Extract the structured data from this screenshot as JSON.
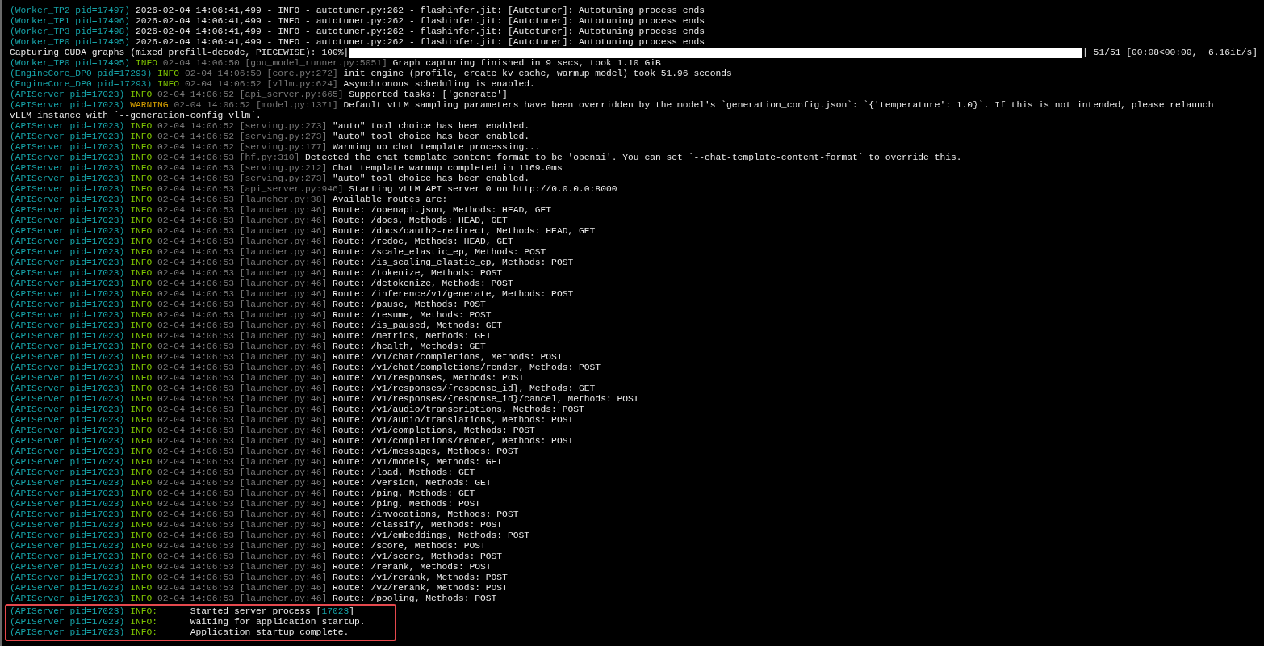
{
  "lines": [
    {
      "kind": "plain",
      "source": "(Worker_TP2 pid=17497)",
      "message": "2026-02-04 14:06:41,499 - INFO - autotuner.py:262 - flashinfer.jit: [Autotuner]: Autotuning process ends"
    },
    {
      "kind": "plain",
      "source": "(Worker_TP1 pid=17496)",
      "message": "2026-02-04 14:06:41,499 - INFO - autotuner.py:262 - flashinfer.jit: [Autotuner]: Autotuning process ends"
    },
    {
      "kind": "plain",
      "source": "(Worker_TP3 pid=17498)",
      "message": "2026-02-04 14:06:41,499 - INFO - autotuner.py:262 - flashinfer.jit: [Autotuner]: Autotuning process ends"
    },
    {
      "kind": "plain",
      "source": "(Worker_TP0 pid=17495)",
      "message": "2026-02-04 14:06:41,499 - INFO - autotuner.py:262 - flashinfer.jit: [Autotuner]: Autotuning process ends"
    },
    {
      "kind": "progress",
      "label": "Capturing CUDA graphs (mixed prefill-decode, PIECEWISE): 100%|",
      "level": 1,
      "tail": "| 51/51 [00:08<00:00,  6.16it/s]"
    },
    {
      "kind": "log",
      "source": "(Worker_TP0 pid=17495)",
      "color": "#7ec500",
      "level": "INFO",
      "time": "02-04 14:06:50",
      "location": "[gpu_model_runner.py:5051]",
      "message": "Graph capturing finished in 9 secs, took 1.10 GiB"
    },
    {
      "kind": "log",
      "source": "(EngineCore_DP0 pid=17293)",
      "color": "#7ec500",
      "level": "INFO",
      "time": "02-04 14:06:50",
      "location": "[core.py:272]",
      "message": "init engine (profile, create kv cache, warmup model) took 51.96 seconds"
    },
    {
      "kind": "log",
      "source": "(EngineCore_DP0 pid=17293)",
      "color": "#7ec500",
      "level": "INFO",
      "time": "02-04 14:06:52",
      "location": "[vllm.py:624]",
      "message": "Asynchronous scheduling is enabled."
    },
    {
      "kind": "log",
      "source": "(APIServer pid=17023)",
      "color": "#7ec500",
      "level": "INFO",
      "time": "02-04 14:06:52",
      "location": "[api_server.py:665]",
      "message": "Supported tasks: ['generate']"
    },
    {
      "kind": "log",
      "source": "(APIServer pid=17023)",
      "color": "#d7a000",
      "level": "WARNING",
      "time": "02-04 14:06:52",
      "location": "[model.py:1371]",
      "message": "Default vLLM sampling parameters have been overridden by the model's `generation_config.json`: `{'temperature': 1.0}`. If this is not intended, please relaunch"
    },
    {
      "kind": "continuation",
      "message": "vLLM instance with `--generation-config vllm`."
    },
    {
      "kind": "log",
      "source": "(APIServer pid=17023)",
      "color": "#7ec500",
      "level": "INFO",
      "time": "02-04 14:06:52",
      "location": "[serving.py:273]",
      "message": "\"auto\" tool choice has been enabled."
    },
    {
      "kind": "log",
      "source": "(APIServer pid=17023)",
      "color": "#7ec500",
      "level": "INFO",
      "time": "02-04 14:06:52",
      "location": "[serving.py:273]",
      "message": "\"auto\" tool choice has been enabled."
    },
    {
      "kind": "log",
      "source": "(APIServer pid=17023)",
      "color": "#7ec500",
      "level": "INFO",
      "time": "02-04 14:06:52",
      "location": "[serving.py:177]",
      "message": "Warming up chat template processing..."
    },
    {
      "kind": "log",
      "source": "(APIServer pid=17023)",
      "color": "#7ec500",
      "level": "INFO",
      "time": "02-04 14:06:53",
      "location": "[hf.py:310]",
      "message": "Detected the chat template content format to be 'openai'. You can set `--chat-template-content-format` to override this."
    },
    {
      "kind": "log",
      "source": "(APIServer pid=17023)",
      "color": "#7ec500",
      "level": "INFO",
      "time": "02-04 14:06:53",
      "location": "[serving.py:212]",
      "message": "Chat template warmup completed in 1169.0ms"
    },
    {
      "kind": "log",
      "source": "(APIServer pid=17023)",
      "color": "#7ec500",
      "level": "INFO",
      "time": "02-04 14:06:53",
      "location": "[serving.py:273]",
      "message": "\"auto\" tool choice has been enabled."
    },
    {
      "kind": "log",
      "source": "(APIServer pid=17023)",
      "color": "#7ec500",
      "level": "INFO",
      "time": "02-04 14:06:53",
      "location": "[api_server.py:946]",
      "message": "Starting vLLM API server 0 on http://0.0.0.0:8000"
    },
    {
      "kind": "log",
      "source": "(APIServer pid=17023)",
      "color": "#7ec500",
      "level": "INFO",
      "time": "02-04 14:06:53",
      "location": "[launcher.py:38]",
      "message": "Available routes are:"
    },
    {
      "kind": "log",
      "source": "(APIServer pid=17023)",
      "color": "#7ec500",
      "level": "INFO",
      "time": "02-04 14:06:53",
      "location": "[launcher.py:46]",
      "message": "Route: /openapi.json, Methods: HEAD, GET"
    },
    {
      "kind": "log",
      "source": "(APIServer pid=17023)",
      "color": "#7ec500",
      "level": "INFO",
      "time": "02-04 14:06:53",
      "location": "[launcher.py:46]",
      "message": "Route: /docs, Methods: HEAD, GET"
    },
    {
      "kind": "log",
      "source": "(APIServer pid=17023)",
      "color": "#7ec500",
      "level": "INFO",
      "time": "02-04 14:06:53",
      "location": "[launcher.py:46]",
      "message": "Route: /docs/oauth2-redirect, Methods: HEAD, GET"
    },
    {
      "kind": "log",
      "source": "(APIServer pid=17023)",
      "color": "#7ec500",
      "level": "INFO",
      "time": "02-04 14:06:53",
      "location": "[launcher.py:46]",
      "message": "Route: /redoc, Methods: HEAD, GET"
    },
    {
      "kind": "log",
      "source": "(APIServer pid=17023)",
      "color": "#7ec500",
      "level": "INFO",
      "time": "02-04 14:06:53",
      "location": "[launcher.py:46]",
      "message": "Route: /scale_elastic_ep, Methods: POST"
    },
    {
      "kind": "log",
      "source": "(APIServer pid=17023)",
      "color": "#7ec500",
      "level": "INFO",
      "time": "02-04 14:06:53",
      "location": "[launcher.py:46]",
      "message": "Route: /is_scaling_elastic_ep, Methods: POST"
    },
    {
      "kind": "log",
      "source": "(APIServer pid=17023)",
      "color": "#7ec500",
      "level": "INFO",
      "time": "02-04 14:06:53",
      "location": "[launcher.py:46]",
      "message": "Route: /tokenize, Methods: POST"
    },
    {
      "kind": "log",
      "source": "(APIServer pid=17023)",
      "color": "#7ec500",
      "level": "INFO",
      "time": "02-04 14:06:53",
      "location": "[launcher.py:46]",
      "message": "Route: /detokenize, Methods: POST"
    },
    {
      "kind": "log",
      "source": "(APIServer pid=17023)",
      "color": "#7ec500",
      "level": "INFO",
      "time": "02-04 14:06:53",
      "location": "[launcher.py:46]",
      "message": "Route: /inference/v1/generate, Methods: POST"
    },
    {
      "kind": "log",
      "source": "(APIServer pid=17023)",
      "color": "#7ec500",
      "level": "INFO",
      "time": "02-04 14:06:53",
      "location": "[launcher.py:46]",
      "message": "Route: /pause, Methods: POST"
    },
    {
      "kind": "log",
      "source": "(APIServer pid=17023)",
      "color": "#7ec500",
      "level": "INFO",
      "time": "02-04 14:06:53",
      "location": "[launcher.py:46]",
      "message": "Route: /resume, Methods: POST"
    },
    {
      "kind": "log",
      "source": "(APIServer pid=17023)",
      "color": "#7ec500",
      "level": "INFO",
      "time": "02-04 14:06:53",
      "location": "[launcher.py:46]",
      "message": "Route: /is_paused, Methods: GET"
    },
    {
      "kind": "log",
      "source": "(APIServer pid=17023)",
      "color": "#7ec500",
      "level": "INFO",
      "time": "02-04 14:06:53",
      "location": "[launcher.py:46]",
      "message": "Route: /metrics, Methods: GET"
    },
    {
      "kind": "log",
      "source": "(APIServer pid=17023)",
      "color": "#7ec500",
      "level": "INFO",
      "time": "02-04 14:06:53",
      "location": "[launcher.py:46]",
      "message": "Route: /health, Methods: GET"
    },
    {
      "kind": "log",
      "source": "(APIServer pid=17023)",
      "color": "#7ec500",
      "level": "INFO",
      "time": "02-04 14:06:53",
      "location": "[launcher.py:46]",
      "message": "Route: /v1/chat/completions, Methods: POST"
    },
    {
      "kind": "log",
      "source": "(APIServer pid=17023)",
      "color": "#7ec500",
      "level": "INFO",
      "time": "02-04 14:06:53",
      "location": "[launcher.py:46]",
      "message": "Route: /v1/chat/completions/render, Methods: POST"
    },
    {
      "kind": "log",
      "source": "(APIServer pid=17023)",
      "color": "#7ec500",
      "level": "INFO",
      "time": "02-04 14:06:53",
      "location": "[launcher.py:46]",
      "message": "Route: /v1/responses, Methods: POST"
    },
    {
      "kind": "log",
      "source": "(APIServer pid=17023)",
      "color": "#7ec500",
      "level": "INFO",
      "time": "02-04 14:06:53",
      "location": "[launcher.py:46]",
      "message": "Route: /v1/responses/{response_id}, Methods: GET"
    },
    {
      "kind": "log",
      "source": "(APIServer pid=17023)",
      "color": "#7ec500",
      "level": "INFO",
      "time": "02-04 14:06:53",
      "location": "[launcher.py:46]",
      "message": "Route: /v1/responses/{response_id}/cancel, Methods: POST"
    },
    {
      "kind": "log",
      "source": "(APIServer pid=17023)",
      "color": "#7ec500",
      "level": "INFO",
      "time": "02-04 14:06:53",
      "location": "[launcher.py:46]",
      "message": "Route: /v1/audio/transcriptions, Methods: POST"
    },
    {
      "kind": "log",
      "source": "(APIServer pid=17023)",
      "color": "#7ec500",
      "level": "INFO",
      "time": "02-04 14:06:53",
      "location": "[launcher.py:46]",
      "message": "Route: /v1/audio/translations, Methods: POST"
    },
    {
      "kind": "log",
      "source": "(APIServer pid=17023)",
      "color": "#7ec500",
      "level": "INFO",
      "time": "02-04 14:06:53",
      "location": "[launcher.py:46]",
      "message": "Route: /v1/completions, Methods: POST"
    },
    {
      "kind": "log",
      "source": "(APIServer pid=17023)",
      "color": "#7ec500",
      "level": "INFO",
      "time": "02-04 14:06:53",
      "location": "[launcher.py:46]",
      "message": "Route: /v1/completions/render, Methods: POST"
    },
    {
      "kind": "log",
      "source": "(APIServer pid=17023)",
      "color": "#7ec500",
      "level": "INFO",
      "time": "02-04 14:06:53",
      "location": "[launcher.py:46]",
      "message": "Route: /v1/messages, Methods: POST"
    },
    {
      "kind": "log",
      "source": "(APIServer pid=17023)",
      "color": "#7ec500",
      "level": "INFO",
      "time": "02-04 14:06:53",
      "location": "[launcher.py:46]",
      "message": "Route: /v1/models, Methods: GET"
    },
    {
      "kind": "log",
      "source": "(APIServer pid=17023)",
      "color": "#7ec500",
      "level": "INFO",
      "time": "02-04 14:06:53",
      "location": "[launcher.py:46]",
      "message": "Route: /load, Methods: GET"
    },
    {
      "kind": "log",
      "source": "(APIServer pid=17023)",
      "color": "#7ec500",
      "level": "INFO",
      "time": "02-04 14:06:53",
      "location": "[launcher.py:46]",
      "message": "Route: /version, Methods: GET"
    },
    {
      "kind": "log",
      "source": "(APIServer pid=17023)",
      "color": "#7ec500",
      "level": "INFO",
      "time": "02-04 14:06:53",
      "location": "[launcher.py:46]",
      "message": "Route: /ping, Methods: GET"
    },
    {
      "kind": "log",
      "source": "(APIServer pid=17023)",
      "color": "#7ec500",
      "level": "INFO",
      "time": "02-04 14:06:53",
      "location": "[launcher.py:46]",
      "message": "Route: /ping, Methods: POST"
    },
    {
      "kind": "log",
      "source": "(APIServer pid=17023)",
      "color": "#7ec500",
      "level": "INFO",
      "time": "02-04 14:06:53",
      "location": "[launcher.py:46]",
      "message": "Route: /invocations, Methods: POST"
    },
    {
      "kind": "log",
      "source": "(APIServer pid=17023)",
      "color": "#7ec500",
      "level": "INFO",
      "time": "02-04 14:06:53",
      "location": "[launcher.py:46]",
      "message": "Route: /classify, Methods: POST"
    },
    {
      "kind": "log",
      "source": "(APIServer pid=17023)",
      "color": "#7ec500",
      "level": "INFO",
      "time": "02-04 14:06:53",
      "location": "[launcher.py:46]",
      "message": "Route: /v1/embeddings, Methods: POST"
    },
    {
      "kind": "log",
      "source": "(APIServer pid=17023)",
      "color": "#7ec500",
      "level": "INFO",
      "time": "02-04 14:06:53",
      "location": "[launcher.py:46]",
      "message": "Route: /score, Methods: POST"
    },
    {
      "kind": "log",
      "source": "(APIServer pid=17023)",
      "color": "#7ec500",
      "level": "INFO",
      "time": "02-04 14:06:53",
      "location": "[launcher.py:46]",
      "message": "Route: /v1/score, Methods: POST"
    },
    {
      "kind": "log",
      "source": "(APIServer pid=17023)",
      "color": "#7ec500",
      "level": "INFO",
      "time": "02-04 14:06:53",
      "location": "[launcher.py:46]",
      "message": "Route: /rerank, Methods: POST"
    },
    {
      "kind": "log",
      "source": "(APIServer pid=17023)",
      "color": "#7ec500",
      "level": "INFO",
      "time": "02-04 14:06:53",
      "location": "[launcher.py:46]",
      "message": "Route: /v1/rerank, Methods: POST"
    },
    {
      "kind": "log",
      "source": "(APIServer pid=17023)",
      "color": "#7ec500",
      "level": "INFO",
      "time": "02-04 14:06:53",
      "location": "[launcher.py:46]",
      "message": "Route: /v2/rerank, Methods: POST"
    },
    {
      "kind": "log",
      "source": "(APIServer pid=17023)",
      "color": "#7ec500",
      "level": "INFO",
      "time": "02-04 14:06:53",
      "location": "[launcher.py:46]",
      "message": "Route: /pooling, Methods: POST"
    }
  ],
  "highlighted_lines": [
    {
      "source": "(APIServer pid=17023)",
      "color": "#7ec500",
      "level": "INFO:",
      "message": "Started server process [",
      "pid": "17023",
      "message_end": "]"
    },
    {
      "source": "(APIServer pid=17023)",
      "color": "#7ec500",
      "level": "INFO:",
      "message": "Waiting for application startup."
    },
    {
      "source": "(APIServer pid=17023)",
      "color": "#7ec500",
      "level": "INFO:",
      "message": "Application startup complete."
    }
  ]
}
